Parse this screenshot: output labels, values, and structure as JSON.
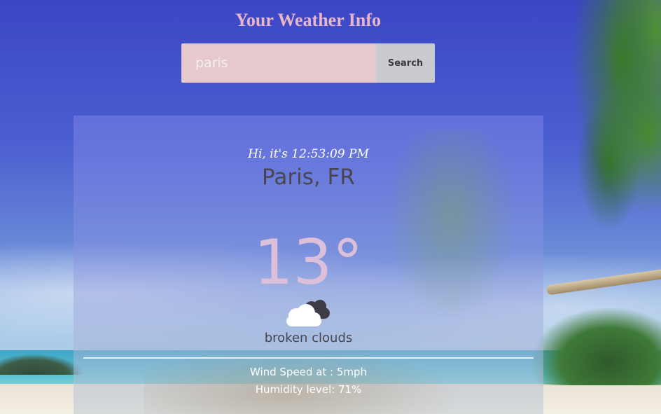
{
  "header": {
    "title": "Your Weather Info"
  },
  "search": {
    "value": "paris",
    "placeholder": "",
    "button_label": "Search"
  },
  "weather": {
    "greeting": "Hi, it's 12:53:09 PM",
    "location": "Paris, FR",
    "temperature": "13°",
    "icon": "broken-clouds-icon",
    "description": "broken clouds",
    "wind": "Wind Speed at : 5mph",
    "humidity": "Humidity level: 71%"
  },
  "colors": {
    "title": "#e8b6c8",
    "search_input_bg": "#e6c9cc",
    "search_button_bg": "#c9cbd0",
    "temperature": "#dcbfd8",
    "location": "#4a4650"
  }
}
